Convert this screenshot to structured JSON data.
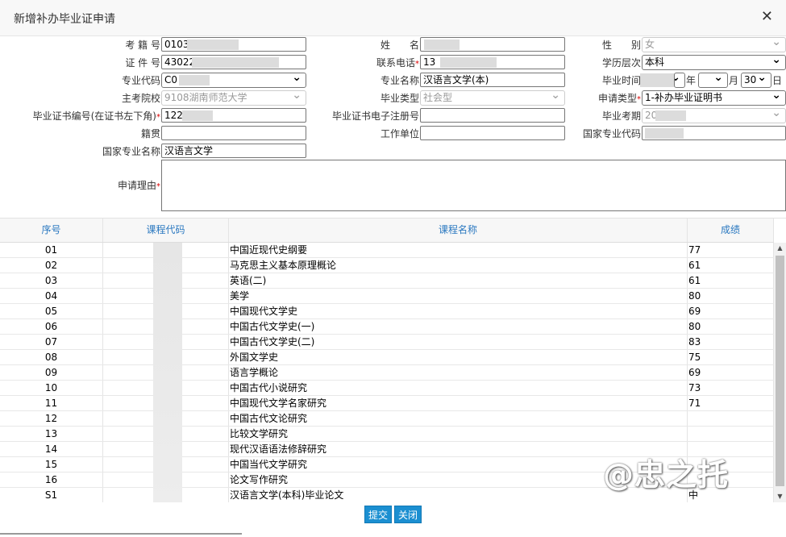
{
  "dialog": {
    "title": "新增补办毕业证申请",
    "close_glyph": "✕"
  },
  "form": {
    "exam_no": {
      "label": "考 籍 号",
      "value": "0103"
    },
    "name": {
      "label": "姓　　名",
      "value": ""
    },
    "gender": {
      "label": "性　　别",
      "value": "女"
    },
    "id_no": {
      "label": "证 件 号",
      "value": "43022"
    },
    "phone": {
      "label": "联系电话",
      "value": "13"
    },
    "edu_level": {
      "label": "学历层次",
      "value": "本科"
    },
    "major_code": {
      "label": "专业代码",
      "value": "C0"
    },
    "major_name": {
      "label": "专业名称",
      "value": "汉语言文学(本)"
    },
    "grad_time": {
      "label": "毕业时间",
      "year_suffix": "年",
      "month_suffix": "月",
      "day_value": "30",
      "day_suffix": "日"
    },
    "school": {
      "label": "主考院校",
      "value": "9108湖南师范大学"
    },
    "grad_type": {
      "label": "毕业类型",
      "value": "社会型"
    },
    "apply_type": {
      "label": "申请类型",
      "value": "1-补办毕业证明书"
    },
    "cert_no": {
      "label": "毕业证书编号(在证书左下角)",
      "value": "122"
    },
    "cert_reg_no": {
      "label": "毕业证书电子注册号",
      "value": ""
    },
    "grad_period": {
      "label": "毕业考期",
      "value": "20"
    },
    "native_place": {
      "label": "籍贯",
      "value": ""
    },
    "work_unit": {
      "label": "工作单位",
      "value": ""
    },
    "national_major_code": {
      "label": "国家专业代码",
      "value": ""
    },
    "national_major_name": {
      "label": "国家专业名称",
      "value": "汉语言文学"
    },
    "reason": {
      "label": "申请理由",
      "value": ""
    },
    "required_mark": "*"
  },
  "grid": {
    "headers": [
      "序号",
      "课程代码",
      "课程名称",
      "成绩"
    ],
    "rows": [
      {
        "no": "01",
        "name": "中国近现代史纲要",
        "score": "77"
      },
      {
        "no": "02",
        "name": "马克思主义基本原理概论",
        "score": "61"
      },
      {
        "no": "03",
        "name": "英语(二)",
        "score": "61"
      },
      {
        "no": "04",
        "name": "美学",
        "score": "80"
      },
      {
        "no": "05",
        "name": "中国现代文学史",
        "score": "69"
      },
      {
        "no": "06",
        "name": "中国古代文学史(一)",
        "score": "80"
      },
      {
        "no": "07",
        "name": "中国古代文学史(二)",
        "score": "83"
      },
      {
        "no": "08",
        "name": "外国文学史",
        "score": "75"
      },
      {
        "no": "09",
        "name": "语言学概论",
        "score": "69"
      },
      {
        "no": "10",
        "name": "中国古代小说研究",
        "score": "73"
      },
      {
        "no": "11",
        "name": "中国现代文学名家研究",
        "score": "71"
      },
      {
        "no": "12",
        "name": "中国古代文论研究",
        "score": ""
      },
      {
        "no": "13",
        "name": "比较文学研究",
        "score": ""
      },
      {
        "no": "14",
        "name": "现代汉语语法修辞研究",
        "score": ""
      },
      {
        "no": "15",
        "name": "中国当代文学研究",
        "score": ""
      },
      {
        "no": "16",
        "name": "论文写作研究",
        "score": ""
      },
      {
        "no": "S1",
        "name": "汉语言文学(本科)毕业论文",
        "score": "中"
      }
    ]
  },
  "buttons": {
    "submit": "提交",
    "close": "关闭"
  },
  "watermark": "@忠之托",
  "colors": {
    "accent": "#1b8fd1",
    "header_text": "#2a78c0"
  }
}
